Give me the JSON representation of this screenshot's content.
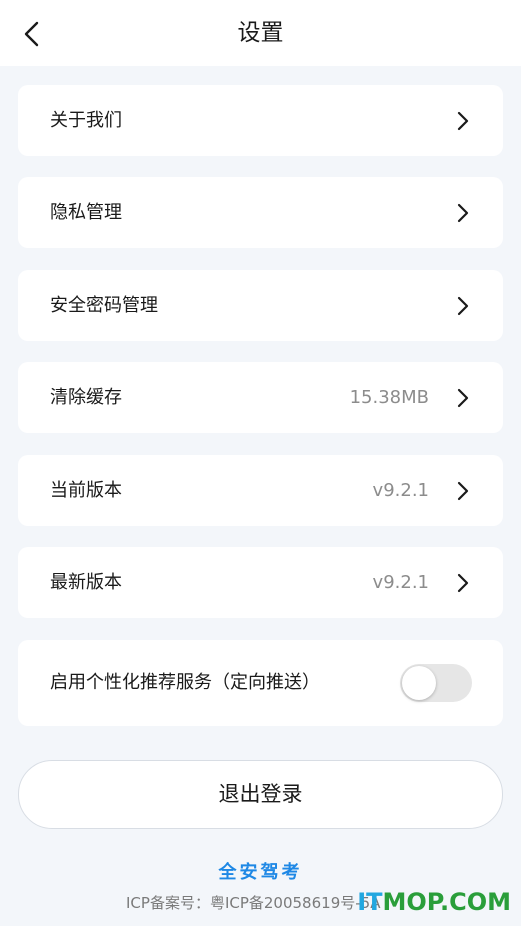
{
  "header": {
    "title": "设置"
  },
  "settings": [
    {
      "label": "关于我们",
      "value": ""
    },
    {
      "label": "隐私管理",
      "value": ""
    },
    {
      "label": "安全密码管理",
      "value": ""
    },
    {
      "label": "清除缓存",
      "value": "15.38MB"
    },
    {
      "label": "当前版本",
      "value": "v9.2.1"
    },
    {
      "label": "最新版本",
      "value": "v9.2.1"
    }
  ],
  "personalized": {
    "label": "启用个性化推荐服务（定向推送）",
    "enabled": false
  },
  "logout_label": "退出登录",
  "footer": {
    "brand": "全安驾考",
    "icp": "ICP备案号：粤ICP备20058619号-5A"
  },
  "watermark": {
    "part_a": "IT",
    "part_b": "MOP.COM"
  },
  "colors": {
    "accent": "#1e88e5",
    "background": "#f3f6fa",
    "toggle_off": "#e6e6e6"
  },
  "icons": {
    "back": "chevron-left-icon",
    "row_arrow": "chevron-right-icon"
  }
}
